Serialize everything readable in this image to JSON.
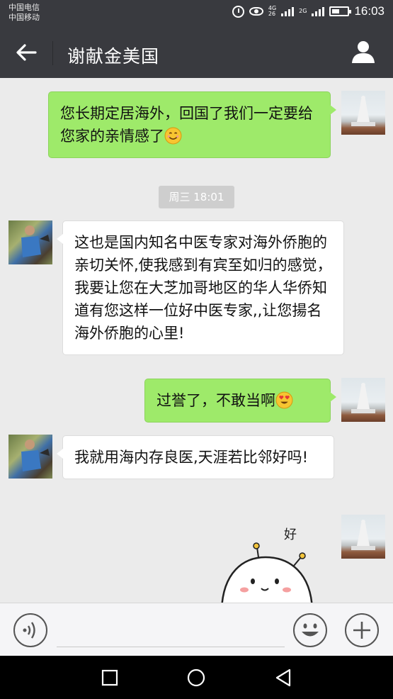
{
  "status_bar": {
    "carrier_1": "中国电信",
    "carrier_2": "中国移动",
    "network_1": "4G",
    "network_1b": "26",
    "network_2": "2G",
    "time": "16:03"
  },
  "header": {
    "title": "谢献金美国",
    "back_icon": "arrow-left-icon",
    "profile_icon": "person-icon"
  },
  "messages": [
    {
      "side": "out",
      "text": "您长期定居海外，回国了我们一定要给您家的亲情感了",
      "emoji": "smile"
    },
    {
      "side": "in",
      "text": "这也是国内知名中医专家对海外侨胞的亲切关怀,使我感到有宾至如归的感觉，我要让您在大芝加哥地区的华人华侨知道有您这样一位好中医专家,,让您揚名海外侨胞的心里!"
    },
    {
      "side": "out",
      "text": "过誉了，不敢当啊",
      "emoji": "heart-eyes"
    },
    {
      "side": "in",
      "text": "我就用海内存良医,天涯若比邻好吗!"
    }
  ],
  "timestamp": "周三 18:01",
  "sticker": {
    "text": "好",
    "icon": "blob-ok-sticker"
  },
  "input_bar": {
    "voice_icon": "voice-icon",
    "emoji_icon": "emoji-icon",
    "plus_icon": "plus-icon",
    "placeholder": ""
  },
  "colors": {
    "header_bg": "#393a3f",
    "chat_bg": "#ebebeb",
    "outgoing_bubble": "#9eea6a",
    "incoming_bubble": "#ffffff"
  }
}
